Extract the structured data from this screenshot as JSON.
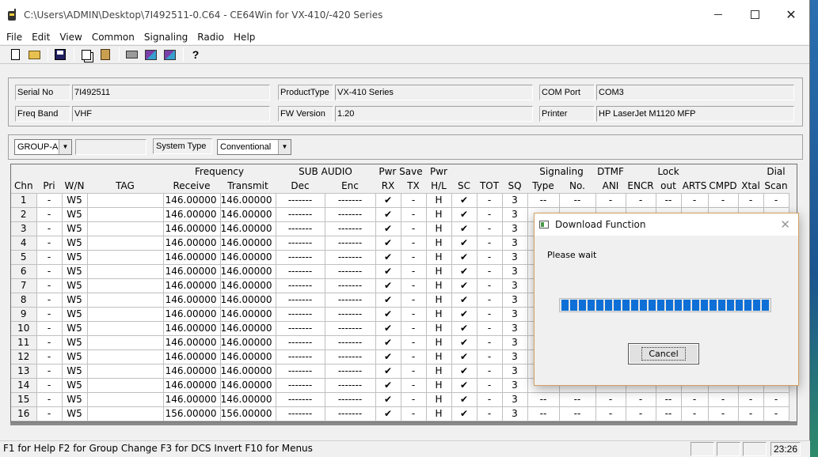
{
  "window": {
    "title": "C:\\Users\\ADMIN\\Desktop\\7I492511-0.C64 - CE64Win for VX-410/-420 Series",
    "close_glyph": "✕"
  },
  "menu": [
    "File",
    "Edit",
    "View",
    "Common",
    "Signaling",
    "Radio",
    "Help"
  ],
  "toolbar": {
    "icons": [
      "new-icon",
      "open-icon",
      "save-icon",
      "copy-icon",
      "paste-icon",
      "print-icon",
      "read-radio-icon",
      "write-radio-icon",
      "help-icon"
    ],
    "help_glyph": "?"
  },
  "info": {
    "serial_no_label": "Serial No",
    "serial_no": "7I492511",
    "product_type_label": "ProductType",
    "product_type": "VX-410 Series",
    "com_port_label": "COM Port",
    "com_port": "COM3",
    "freq_band_label": "Freq Band",
    "freq_band": "VHF",
    "fw_version_label": "FW Version",
    "fw_version": "1.20",
    "printer_label": "Printer",
    "printer": "HP LaserJet M1120 MFP"
  },
  "group": {
    "group_select": "GROUP-A",
    "system_type_label": "System Type",
    "system_type": "Conventional",
    "dropdown_glyph": "▼"
  },
  "grid": {
    "header_top": {
      "frequency": "Frequency",
      "sub_audio": "SUB AUDIO",
      "pwr_save": "Pwr Save",
      "pwr": "Pwr",
      "signaling": "Signaling",
      "dtmf": "DTMF",
      "lock": "Lock",
      "dial": "Dial"
    },
    "columns": [
      "Chn",
      "Pri",
      "W/N",
      "TAG",
      "Receive",
      "Transmit",
      "Dec",
      "Enc",
      "RX",
      "TX",
      "H/L",
      "SC",
      "TOT",
      "SQ",
      "Type",
      "No.",
      "ANI",
      "ENCR",
      "out",
      "ARTS",
      "CMPD",
      "Xtal",
      "Scan"
    ],
    "rows": [
      [
        "1",
        "-",
        "W5",
        "",
        "146.00000",
        "146.00000",
        "-------",
        "-------",
        "✔",
        "-",
        "H",
        "✔",
        "-",
        "3",
        "--",
        "--",
        "-",
        "-",
        "--",
        "-",
        "-",
        "-",
        "-"
      ],
      [
        "2",
        "-",
        "W5",
        "",
        "146.00000",
        "146.00000",
        "-------",
        "-------",
        "✔",
        "-",
        "H",
        "✔",
        "-",
        "3",
        "--",
        "--",
        "-",
        "-",
        "--",
        "-",
        "-",
        "-",
        "-"
      ],
      [
        "3",
        "-",
        "W5",
        "",
        "146.00000",
        "146.00000",
        "-------",
        "-------",
        "✔",
        "-",
        "H",
        "✔",
        "-",
        "3",
        "--",
        "--",
        "-",
        "-",
        "--",
        "-",
        "-",
        "-",
        "-"
      ],
      [
        "4",
        "-",
        "W5",
        "",
        "146.00000",
        "146.00000",
        "-------",
        "-------",
        "✔",
        "-",
        "H",
        "✔",
        "-",
        "3",
        "--",
        "--",
        "-",
        "-",
        "--",
        "-",
        "-",
        "-",
        "-"
      ],
      [
        "5",
        "-",
        "W5",
        "",
        "146.00000",
        "146.00000",
        "-------",
        "-------",
        "✔",
        "-",
        "H",
        "✔",
        "-",
        "3",
        "--",
        "--",
        "-",
        "-",
        "--",
        "-",
        "-",
        "-",
        "-"
      ],
      [
        "6",
        "-",
        "W5",
        "",
        "146.00000",
        "146.00000",
        "-------",
        "-------",
        "✔",
        "-",
        "H",
        "✔",
        "-",
        "3",
        "--",
        "--",
        "-",
        "-",
        "--",
        "-",
        "-",
        "-",
        "-"
      ],
      [
        "7",
        "-",
        "W5",
        "",
        "146.00000",
        "146.00000",
        "-------",
        "-------",
        "✔",
        "-",
        "H",
        "✔",
        "-",
        "3",
        "--",
        "--",
        "-",
        "-",
        "--",
        "-",
        "-",
        "-",
        "-"
      ],
      [
        "8",
        "-",
        "W5",
        "",
        "146.00000",
        "146.00000",
        "-------",
        "-------",
        "✔",
        "-",
        "H",
        "✔",
        "-",
        "3",
        "--",
        "--",
        "-",
        "-",
        "--",
        "-",
        "-",
        "-",
        "-"
      ],
      [
        "9",
        "-",
        "W5",
        "",
        "146.00000",
        "146.00000",
        "-------",
        "-------",
        "✔",
        "-",
        "H",
        "✔",
        "-",
        "3",
        "--",
        "--",
        "-",
        "-",
        "--",
        "-",
        "-",
        "-",
        "-"
      ],
      [
        "10",
        "-",
        "W5",
        "",
        "146.00000",
        "146.00000",
        "-------",
        "-------",
        "✔",
        "-",
        "H",
        "✔",
        "-",
        "3",
        "--",
        "--",
        "-",
        "-",
        "--",
        "-",
        "-",
        "-",
        "-"
      ],
      [
        "11",
        "-",
        "W5",
        "",
        "146.00000",
        "146.00000",
        "-------",
        "-------",
        "✔",
        "-",
        "H",
        "✔",
        "-",
        "3",
        "--",
        "--",
        "-",
        "-",
        "--",
        "-",
        "-",
        "-",
        "-"
      ],
      [
        "12",
        "-",
        "W5",
        "",
        "146.00000",
        "146.00000",
        "-------",
        "-------",
        "✔",
        "-",
        "H",
        "✔",
        "-",
        "3",
        "--",
        "--",
        "-",
        "-",
        "--",
        "-",
        "-",
        "-",
        "-"
      ],
      [
        "13",
        "-",
        "W5",
        "",
        "146.00000",
        "146.00000",
        "-------",
        "-------",
        "✔",
        "-",
        "H",
        "✔",
        "-",
        "3",
        "--",
        "--",
        "-",
        "-",
        "--",
        "-",
        "-",
        "-",
        "-"
      ],
      [
        "14",
        "-",
        "W5",
        "",
        "146.00000",
        "146.00000",
        "-------",
        "-------",
        "✔",
        "-",
        "H",
        "✔",
        "-",
        "3",
        "--",
        "--",
        "-",
        "-",
        "--",
        "-",
        "-",
        "-",
        "-"
      ],
      [
        "15",
        "-",
        "W5",
        "",
        "146.00000",
        "146.00000",
        "-------",
        "-------",
        "✔",
        "-",
        "H",
        "✔",
        "-",
        "3",
        "--",
        "--",
        "-",
        "-",
        "--",
        "-",
        "-",
        "-",
        "-"
      ],
      [
        "16",
        "-",
        "W5",
        "",
        "156.00000",
        "156.00000",
        "-------",
        "-------",
        "✔",
        "-",
        "H",
        "✔",
        "-",
        "3",
        "--",
        "--",
        "-",
        "-",
        "--",
        "-",
        "-",
        "-",
        "-"
      ]
    ]
  },
  "status": {
    "help_text": "F1 for Help   F2 for Group Change   F3 for DCS Invert   F10 for Menus",
    "time": "23:26"
  },
  "dialog": {
    "title": "Download Function",
    "message": "Please wait",
    "progress": 1.0,
    "cancel_label": "Cancel",
    "close_glyph": "✕"
  },
  "colors": {
    "progress": "#0e6fd6",
    "dialog_border": "#d4a060",
    "desktop": "#1565a6"
  }
}
